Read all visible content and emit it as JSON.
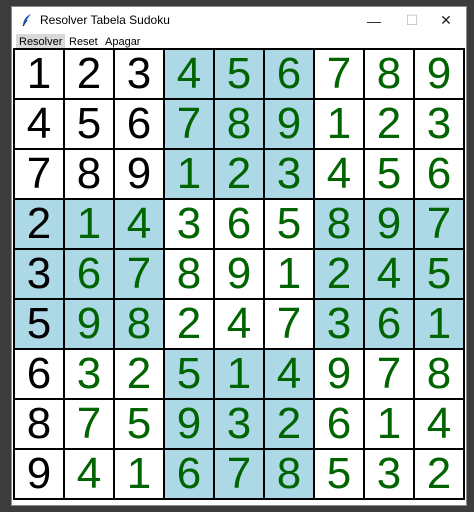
{
  "window": {
    "title": "Resolver Tabela Sudoku"
  },
  "titlebar_buttons": {
    "minimize": "—",
    "maximize": "☐",
    "close": "✕"
  },
  "menu": [
    "Resolver",
    "Reset",
    "Apagar"
  ],
  "colors": {
    "light_box": "#ffffff",
    "shaded_box": "#add8e6",
    "given_digit": "#000000",
    "solved_digit": "#006400"
  },
  "board": {
    "rows": [
      [
        "1",
        "2",
        "3",
        "4",
        "5",
        "6",
        "7",
        "8",
        "9"
      ],
      [
        "4",
        "5",
        "6",
        "7",
        "8",
        "9",
        "1",
        "2",
        "3"
      ],
      [
        "7",
        "8",
        "9",
        "1",
        "2",
        "3",
        "4",
        "5",
        "6"
      ],
      [
        "2",
        "1",
        "4",
        "3",
        "6",
        "5",
        "8",
        "9",
        "7"
      ],
      [
        "3",
        "6",
        "7",
        "8",
        "9",
        "1",
        "2",
        "4",
        "5"
      ],
      [
        "5",
        "9",
        "8",
        "2",
        "4",
        "7",
        "3",
        "6",
        "1"
      ],
      [
        "6",
        "3",
        "2",
        "5",
        "1",
        "4",
        "9",
        "7",
        "8"
      ],
      [
        "8",
        "7",
        "5",
        "9",
        "3",
        "2",
        "6",
        "1",
        "4"
      ],
      [
        "9",
        "4",
        "1",
        "6",
        "7",
        "8",
        "5",
        "3",
        "2"
      ]
    ],
    "given": [
      [
        true,
        true,
        true,
        false,
        false,
        false,
        false,
        false,
        false
      ],
      [
        true,
        true,
        true,
        false,
        false,
        false,
        false,
        false,
        false
      ],
      [
        true,
        true,
        true,
        false,
        false,
        false,
        false,
        false,
        false
      ],
      [
        true,
        false,
        false,
        false,
        false,
        false,
        false,
        false,
        false
      ],
      [
        true,
        false,
        false,
        false,
        false,
        false,
        false,
        false,
        false
      ],
      [
        true,
        false,
        false,
        false,
        false,
        false,
        false,
        false,
        false
      ],
      [
        true,
        false,
        false,
        false,
        false,
        false,
        false,
        false,
        false
      ],
      [
        true,
        false,
        false,
        false,
        false,
        false,
        false,
        false,
        false
      ],
      [
        true,
        false,
        false,
        false,
        false,
        false,
        false,
        false,
        false
      ]
    ]
  }
}
